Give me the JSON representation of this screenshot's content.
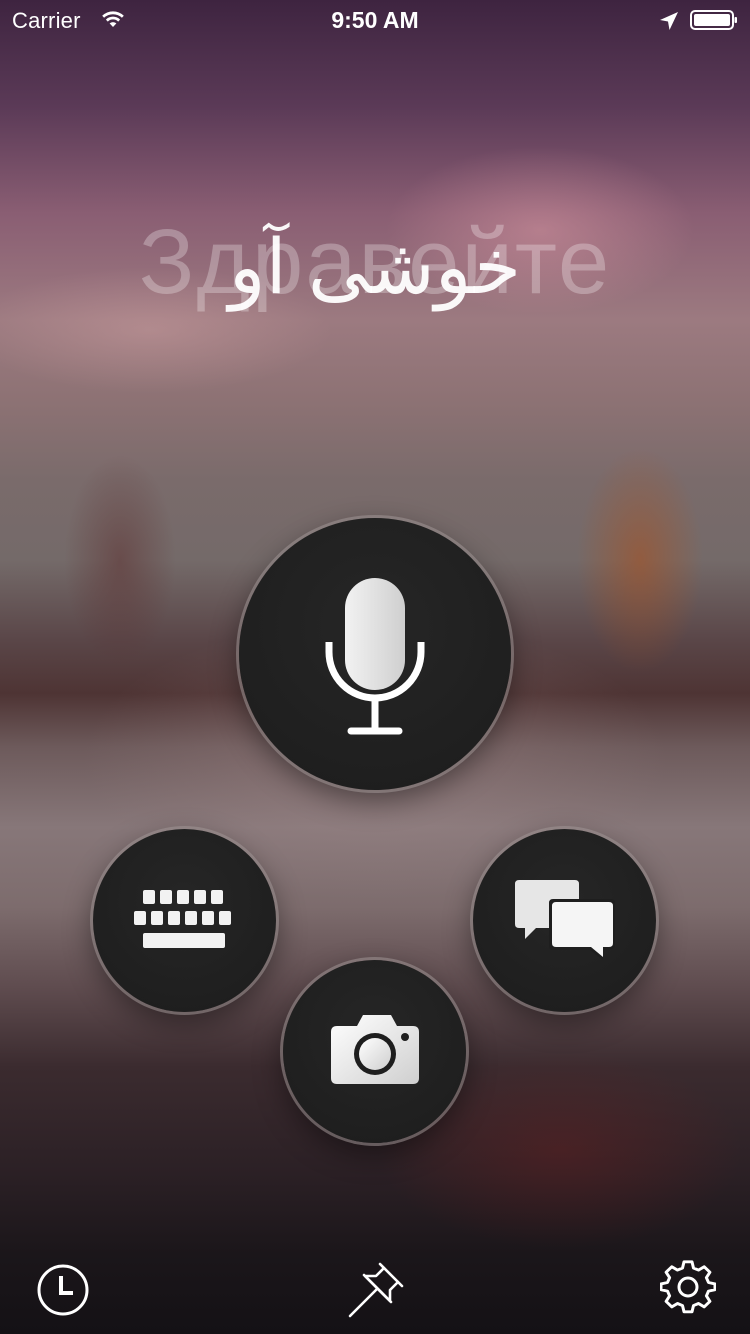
{
  "status_bar": {
    "carrier": "Carrier",
    "time": "9:50 AM",
    "icons": [
      "wifi-icon",
      "location-icon",
      "battery-icon"
    ]
  },
  "greeting": {
    "back_text": "Здравейте",
    "front_text": "خوشی آو"
  },
  "main_actions": {
    "icons": [
      "microphone-icon",
      "keyboard-icon",
      "conversation-icon",
      "camera-icon"
    ]
  },
  "bottom_bar": {
    "icons": [
      "history-icon",
      "pin-icon",
      "settings-icon"
    ]
  },
  "colors": {
    "button_fill": "#1e1e1e",
    "button_ring": "#a09696",
    "icon_light": "#ffffff"
  }
}
